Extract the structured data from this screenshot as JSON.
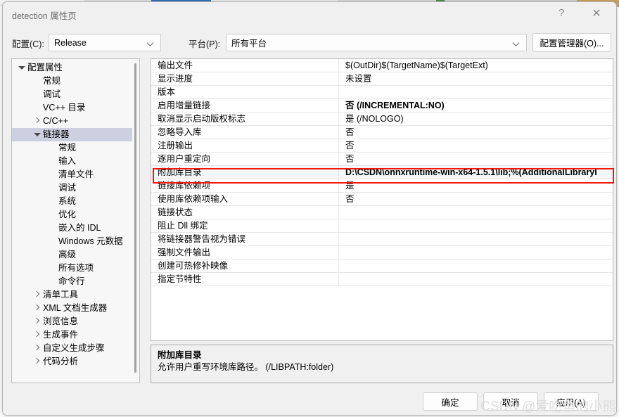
{
  "window": {
    "title": "detection 属性页",
    "help_icon": "?",
    "close_icon": "✕"
  },
  "config_bar": {
    "config_label": "配置(C):",
    "config_value": "Release",
    "platform_label": "平台(P):",
    "platform_value": "所有平台",
    "config_manager_label": "配置管理器(O)..."
  },
  "tree": {
    "items": [
      {
        "label": "配置属性",
        "indent": 0,
        "twisty": "expanded",
        "selected": false
      },
      {
        "label": "常规",
        "indent": 1,
        "twisty": "none",
        "selected": false
      },
      {
        "label": "调试",
        "indent": 1,
        "twisty": "none",
        "selected": false
      },
      {
        "label": "VC++ 目录",
        "indent": 1,
        "twisty": "none",
        "selected": false
      },
      {
        "label": "C/C++",
        "indent": 1,
        "twisty": "collapsed",
        "selected": false
      },
      {
        "label": "链接器",
        "indent": 1,
        "twisty": "expanded",
        "selected": true
      },
      {
        "label": "常规",
        "indent": 2,
        "twisty": "none",
        "selected": false
      },
      {
        "label": "输入",
        "indent": 2,
        "twisty": "none",
        "selected": false
      },
      {
        "label": "清单文件",
        "indent": 2,
        "twisty": "none",
        "selected": false
      },
      {
        "label": "调试",
        "indent": 2,
        "twisty": "none",
        "selected": false
      },
      {
        "label": "系统",
        "indent": 2,
        "twisty": "none",
        "selected": false
      },
      {
        "label": "优化",
        "indent": 2,
        "twisty": "none",
        "selected": false
      },
      {
        "label": "嵌入的 IDL",
        "indent": 2,
        "twisty": "none",
        "selected": false
      },
      {
        "label": "Windows 元数据",
        "indent": 2,
        "twisty": "none",
        "selected": false
      },
      {
        "label": "高级",
        "indent": 2,
        "twisty": "none",
        "selected": false
      },
      {
        "label": "所有选项",
        "indent": 2,
        "twisty": "none",
        "selected": false
      },
      {
        "label": "命令行",
        "indent": 2,
        "twisty": "none",
        "selected": false
      },
      {
        "label": "清单工具",
        "indent": 1,
        "twisty": "collapsed",
        "selected": false
      },
      {
        "label": "XML 文档生成器",
        "indent": 1,
        "twisty": "collapsed",
        "selected": false
      },
      {
        "label": "浏览信息",
        "indent": 1,
        "twisty": "collapsed",
        "selected": false
      },
      {
        "label": "生成事件",
        "indent": 1,
        "twisty": "collapsed",
        "selected": false
      },
      {
        "label": "自定义生成步骤",
        "indent": 1,
        "twisty": "collapsed",
        "selected": false
      },
      {
        "label": "代码分析",
        "indent": 1,
        "twisty": "collapsed",
        "selected": false
      }
    ]
  },
  "grid": {
    "rows": [
      {
        "name": "输出文件",
        "value": "$(OutDir)$(TargetName)$(TargetExt)",
        "bold": false,
        "selected": false
      },
      {
        "name": "显示进度",
        "value": "未设置",
        "bold": false,
        "selected": false
      },
      {
        "name": "版本",
        "value": "",
        "bold": false,
        "selected": false
      },
      {
        "name": "启用增量链接",
        "value": "否 (/INCREMENTAL:NO)",
        "bold": true,
        "selected": false
      },
      {
        "name": "取消显示启动版权标志",
        "value": "是 (/NOLOGO)",
        "bold": false,
        "selected": false
      },
      {
        "name": "忽略导入库",
        "value": "否",
        "bold": false,
        "selected": false
      },
      {
        "name": "注册输出",
        "value": "否",
        "bold": false,
        "selected": false
      },
      {
        "name": "逐用户重定向",
        "value": "否",
        "bold": false,
        "selected": false
      },
      {
        "name": "附加库目录",
        "value": "D:\\CSDN\\onnxruntime-win-x64-1.5.1\\lib;%(AdditionalLibraryI",
        "bold": true,
        "selected": true
      },
      {
        "name": "链接库依赖项",
        "value": "是",
        "bold": false,
        "selected": false
      },
      {
        "name": "使用库依赖项输入",
        "value": "否",
        "bold": false,
        "selected": false
      },
      {
        "name": "链接状态",
        "value": "",
        "bold": false,
        "selected": false
      },
      {
        "name": "阻止 Dll 绑定",
        "value": "",
        "bold": false,
        "selected": false
      },
      {
        "name": "将链接器警告视为错误",
        "value": "",
        "bold": false,
        "selected": false
      },
      {
        "name": "强制文件输出",
        "value": "",
        "bold": false,
        "selected": false
      },
      {
        "name": "创建可热修补映像",
        "value": "",
        "bold": false,
        "selected": false
      },
      {
        "name": "指定节特性",
        "value": "",
        "bold": false,
        "selected": false
      }
    ],
    "highlight_color": "#f41807"
  },
  "description": {
    "title": "附加库目录",
    "text": "允许用户重写环境库路径。 (/LIBPATH:folder)"
  },
  "footer": {
    "ok_label": "确定",
    "cancel_label": "取消",
    "apply_label": "应用(A)"
  },
  "watermark": {
    "text": "CSDN @爱吃鱼的小熊"
  }
}
